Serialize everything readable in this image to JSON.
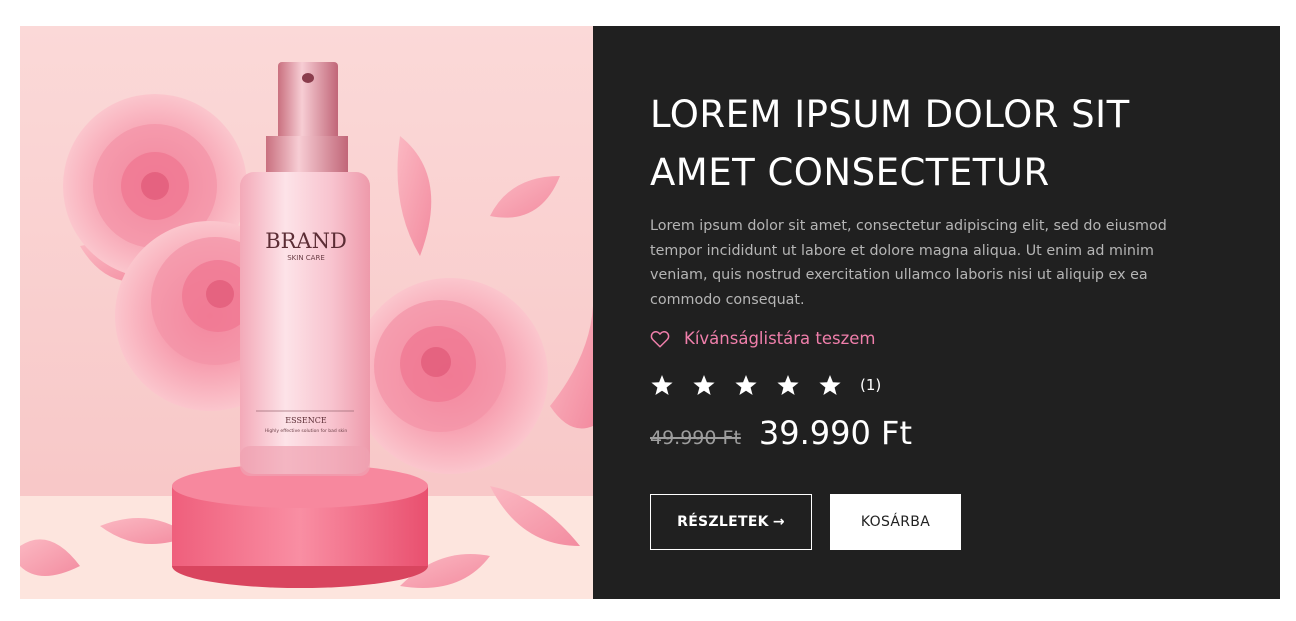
{
  "product_image": {
    "brand": "BRAND",
    "sub": "SKIN CARE",
    "label": "ESSENCE",
    "tagline": "Highly effective solution for bad skin"
  },
  "product": {
    "title": "LOREM IPSUM DOLOR SIT AMET CONSECTETUR",
    "description": "Lorem ipsum dolor sit amet, consectetur adipiscing elit, sed do eiusmod tempor incididunt ut labore et dolore magna aliqua. Ut enim ad minim veniam, quis nostrud exercitation ullamco laboris nisi ut aliquip ex ea commodo consequat.",
    "wishlist_label": "Kívánságlistára teszem",
    "rating": {
      "stars": 5,
      "max": 5,
      "count_label": "(1)"
    },
    "old_price": "49.990 Ft",
    "new_price": "39.990 Ft"
  },
  "buttons": {
    "details_label": "RÉSZLETEK",
    "details_arrow": "→",
    "cart_label": "KOSÁRBA"
  },
  "icons": {
    "wishlist": "heart-outline-icon",
    "star": "star-icon",
    "arrow": "arrow-right-icon"
  },
  "colors": {
    "panel_bg": "#202020",
    "accent_pink": "#f07fab",
    "text_muted": "#b5b5b5",
    "old_price": "#9d9d9d"
  }
}
